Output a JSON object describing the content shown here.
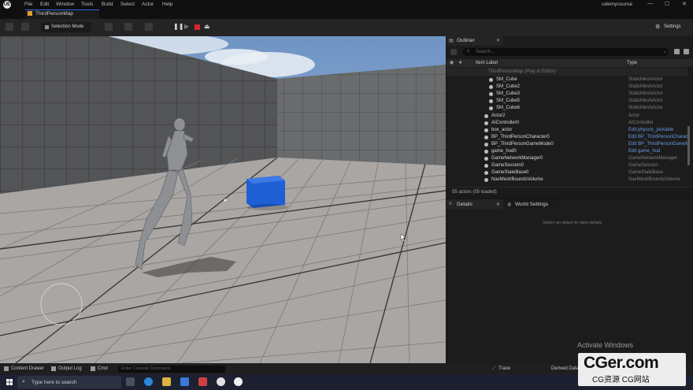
{
  "titlebar": {
    "menus": [
      "File",
      "Edit",
      "Window",
      "Tools",
      "Build",
      "Select",
      "Actor",
      "Help"
    ],
    "project": "udemycourse",
    "logo": "UE",
    "win_min": "—",
    "win_max": "☐",
    "win_close": "✕"
  },
  "tab": {
    "label": "ThirdPersonMap"
  },
  "toolbar": {
    "selection_mode": "Selection Mode",
    "settings": "Settings"
  },
  "outliner": {
    "tab": "Outliner",
    "search_placeholder": "Search...",
    "col_label": "Item Label",
    "col_type": "Type",
    "root": "ThirdPersonMap (Play In Editor)",
    "rows": [
      {
        "label": "SM_Cube",
        "type": "StaticMeshActor",
        "indent": 1,
        "link": false
      },
      {
        "label": "SM_Cube2",
        "type": "StaticMeshActor",
        "indent": 1,
        "link": false
      },
      {
        "label": "SM_Cube3",
        "type": "StaticMeshActor",
        "indent": 1,
        "link": false
      },
      {
        "label": "SM_Cube5",
        "type": "StaticMeshActor",
        "indent": 1,
        "link": false
      },
      {
        "label": "SM_Cube6",
        "type": "StaticMeshActor",
        "indent": 1,
        "link": false
      },
      {
        "label": "Actor2",
        "type": "Actor",
        "indent": 0,
        "link": false
      },
      {
        "label": "AIController0",
        "type": "AIController",
        "indent": 0,
        "link": false
      },
      {
        "label": "box_actor",
        "type": "Edit physcis_pickable",
        "indent": 0,
        "link": true
      },
      {
        "label": "BP_ThirdPersonCharacter0",
        "type": "Edit BP_ThirdPersonCharac",
        "indent": 0,
        "link": true
      },
      {
        "label": "BP_ThirdPersonGameMode0",
        "type": "Edit BP_ThirdPersonGameM",
        "indent": 0,
        "link": true
      },
      {
        "label": "game_hud0",
        "type": "Edit game_hud",
        "indent": 0,
        "link": true
      },
      {
        "label": "GameNetworkManager0",
        "type": "GameNetworkManager",
        "indent": 0,
        "link": false
      },
      {
        "label": "GameSession0",
        "type": "GameSession",
        "indent": 0,
        "link": false
      },
      {
        "label": "GameStateBase0",
        "type": "GameStateBase",
        "indent": 0,
        "link": false
      },
      {
        "label": "NavMeshBoundsVolume",
        "type": "NavMeshBoundsVolume",
        "indent": 0,
        "link": false
      }
    ],
    "status": "55 actors (55 loaded)"
  },
  "details": {
    "tab": "Details",
    "world_tab": "World Settings",
    "empty": "Select an object to view details.",
    "close": "✕"
  },
  "overlay": {
    "activate": "Activate Windows"
  },
  "bottombar": {
    "content_drawer": "Content Drawer",
    "output_log": "Output Log",
    "cmd": "Cmd",
    "console_placeholder": "Enter Console Command",
    "trace": "Trace",
    "derived": "Derived Data"
  },
  "taskbar": {
    "search": "Type here to search"
  },
  "watermark": {
    "main": "CGer.com",
    "sub": "CG资源 CG网站"
  },
  "colors": {
    "accent": "#2a6ad6",
    "stop": "#d02828",
    "cube": "#1f5fd6",
    "link": "#6a9ae8"
  }
}
